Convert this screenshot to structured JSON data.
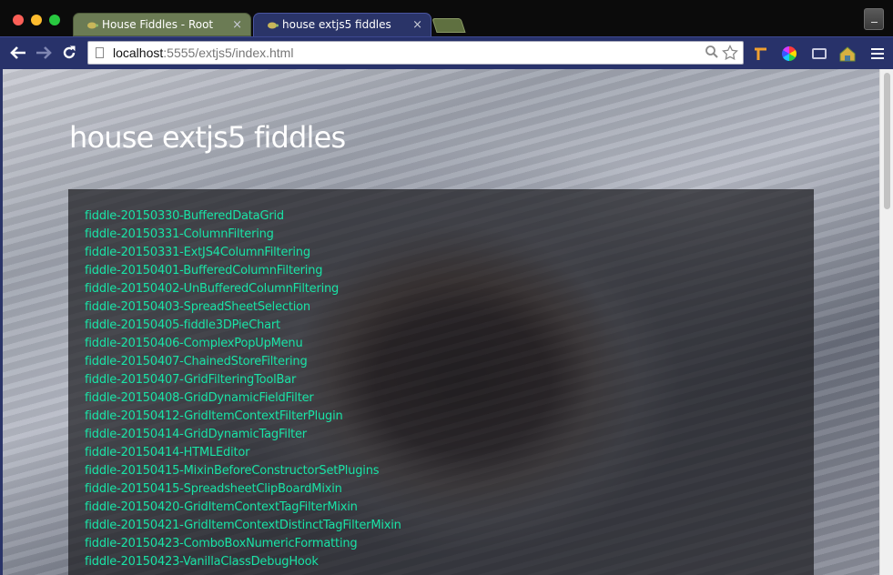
{
  "browser": {
    "tabs": [
      {
        "title": "House Fiddles - Root",
        "close": "×",
        "active": false
      },
      {
        "title": "house extjs5 fiddles",
        "close": "×",
        "active": true
      }
    ],
    "url_host": "localhost",
    "url_rest": ":5555/extjs5/index.html",
    "icons": {
      "back": "arrow-left-icon",
      "forward": "arrow-right-icon",
      "reload": "reload-icon",
      "zoom": "magnifier-icon",
      "bookmark": "star-icon",
      "menu": "hamburger-menu-icon"
    },
    "colors": {
      "toolbar": "#28326a",
      "active_tab": "#2a3468",
      "inactive_tab": "#6b7b54",
      "link": "#19e3a6"
    }
  },
  "page": {
    "title": "house extjs5 fiddles",
    "links": [
      "fiddle-20150330-BufferedDataGrid",
      "fiddle-20150331-ColumnFiltering",
      "fiddle-20150331-ExtJS4ColumnFiltering",
      "fiddle-20150401-BufferedColumnFiltering",
      "fiddle-20150402-UnBufferedColumnFiltering",
      "fiddle-20150403-SpreadSheetSelection",
      "fiddle-20150405-fiddle3DPieChart",
      "fiddle-20150406-ComplexPopUpMenu",
      "fiddle-20150407-ChainedStoreFiltering",
      "fiddle-20150407-GridFilteringToolBar",
      "fiddle-20150408-GridDynamicFieldFilter",
      "fiddle-20150412-GridItemContextFilterPlugin",
      "fiddle-20150414-GridDynamicTagFilter",
      "fiddle-20150414-HTMLEditor",
      "fiddle-20150415-MixinBeforeConstructorSetPlugins",
      "fiddle-20150415-SpreadsheetClipBoardMixin",
      "fiddle-20150420-GridItemContextTagFilterMixin",
      "fiddle-20150421-GridItemContextDistinctTagFilterMixin",
      "fiddle-20150423-ComboBoxNumericFormatting",
      "fiddle-20150423-VanillaClassDebugHook"
    ]
  }
}
